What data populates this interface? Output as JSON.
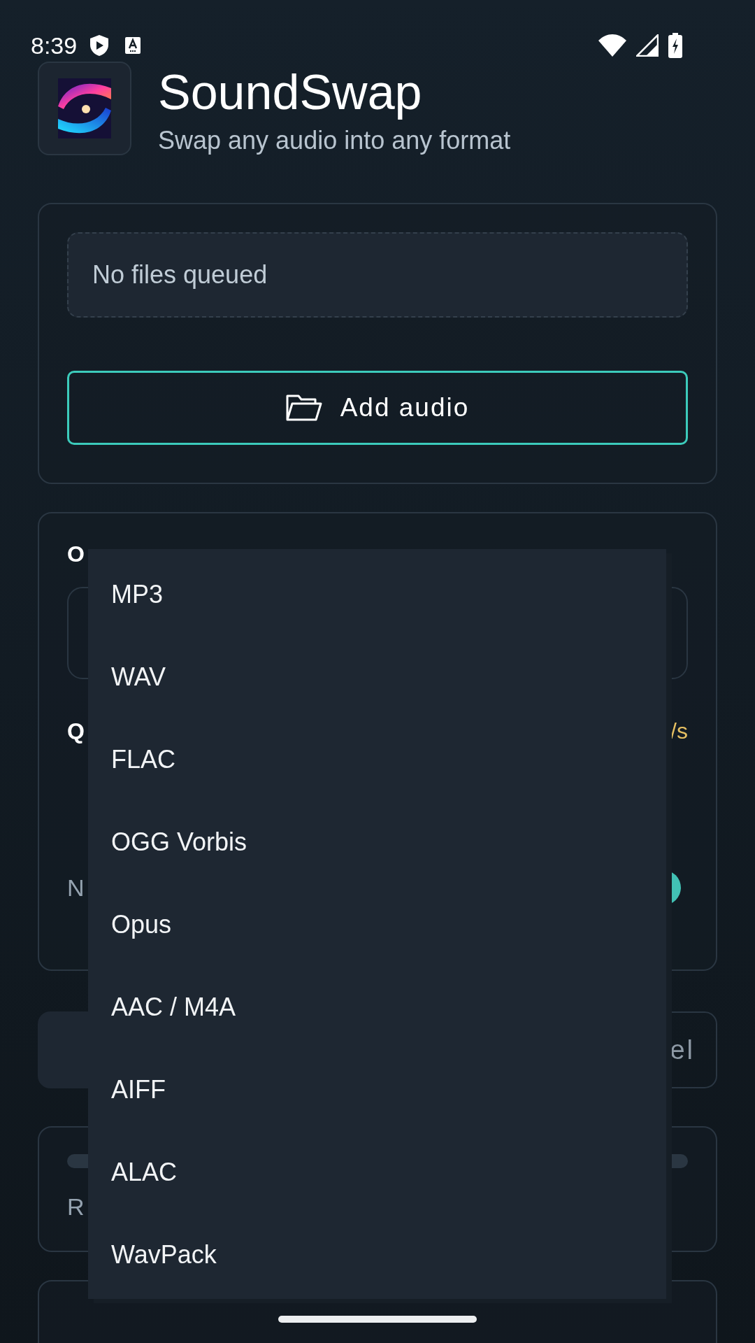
{
  "status_bar": {
    "time": "8:39"
  },
  "header": {
    "title": "SoundSwap",
    "subtitle": "Swap any audio into any format"
  },
  "queue_card": {
    "empty_text": "No files queued",
    "add_button": "Add audio"
  },
  "output_card": {
    "format_label": "O",
    "quality_label": "Q",
    "quality_value": "/s",
    "note_label": "N"
  },
  "actions_card": {
    "right_button": "el"
  },
  "progress_card": {
    "status": "R"
  },
  "format_menu": {
    "items": [
      {
        "label": "MP3"
      },
      {
        "label": "WAV"
      },
      {
        "label": "FLAC"
      },
      {
        "label": "OGG Vorbis"
      },
      {
        "label": "Opus"
      },
      {
        "label": "AAC / M4A"
      },
      {
        "label": "AIFF"
      },
      {
        "label": "ALAC"
      },
      {
        "label": "WavPack"
      }
    ]
  }
}
